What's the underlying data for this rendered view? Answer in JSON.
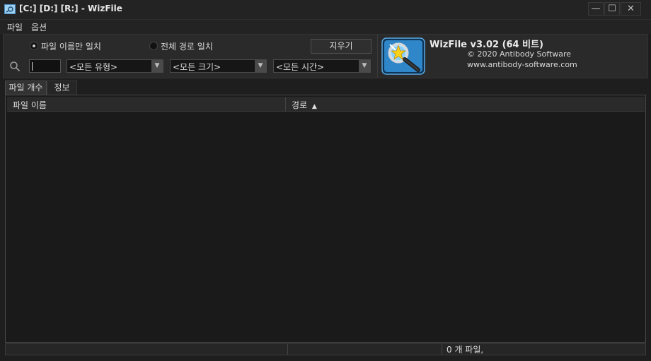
{
  "window": {
    "title": "[C:] [D:] [R:]  - WizFile",
    "minimize_icon": "minimize-icon",
    "maximize_icon": "maximize-icon",
    "close_icon": "close-icon"
  },
  "menu": {
    "file": "파일",
    "options": "옵션"
  },
  "search": {
    "match_mode": {
      "filename_only": "파일 이름만 일치",
      "full_path": "전체 경로 일치",
      "selected": "filename_only"
    },
    "clear_label": "지우기",
    "query_value": "",
    "search_icon": "magnifier-icon",
    "filters": {
      "type": "<모든 유형>",
      "size": "<모든 크기>",
      "time": "<모든 시간>"
    }
  },
  "about": {
    "app_name": "WizFile v3.02 (64 비트)",
    "copyright": "© 2020 Antibody Software",
    "website": "www.antibody-software.com",
    "logo_icon": "wizard-magnifier-logo"
  },
  "tabs": {
    "file_count": "파일 개수",
    "info": "정보",
    "active": "file_count"
  },
  "table": {
    "columns": {
      "name": "파일 이름",
      "path": "경로"
    },
    "sorted_column": "path",
    "sort_direction": "ascending",
    "rows": []
  },
  "status": {
    "text": "0 개 파일,"
  },
  "colors": {
    "background": "#1e1e1e",
    "panel": "#2a2a2a",
    "text": "#d8d8d8"
  }
}
